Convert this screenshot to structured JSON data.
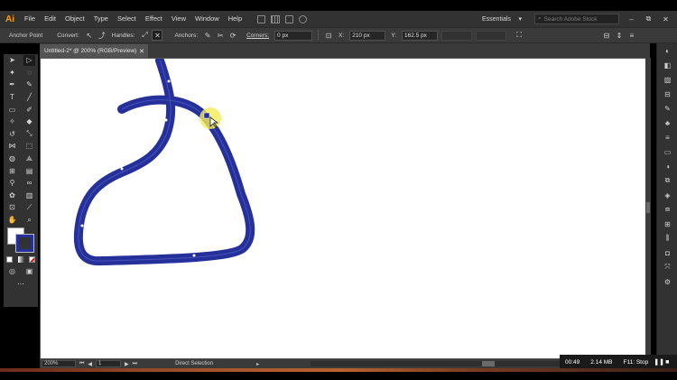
{
  "app": {
    "logo": "Ai"
  },
  "menu": [
    "File",
    "Edit",
    "Object",
    "Type",
    "Select",
    "Effect",
    "View",
    "Window",
    "Help"
  ],
  "workspace": {
    "label": "Essentials"
  },
  "search": {
    "placeholder": "Search Adobe Stock"
  },
  "window_buttons": [
    "–",
    "⧉",
    "✕"
  ],
  "control_bar": {
    "anchor_point": "Anchor Point",
    "convert": "Convert:",
    "handles": "Handles:",
    "anchors": "Anchors:",
    "corners": "Corners:",
    "corner_value": "0 px",
    "x_value": "210 px",
    "y_value": "162.5 px"
  },
  "document_tab": {
    "title": "Untitled-2* @ 200% (RGB/Preview)",
    "close": "✕"
  },
  "status_bar": {
    "zoom": "200%",
    "page": "1",
    "tool": "Direct Selection"
  },
  "recorder": {
    "time": "00:49",
    "size": "2.14 MB",
    "hotkey": "F11: Stop"
  },
  "colors": {
    "stroke": "#25309a",
    "cursor_highlight": "#f4ec57",
    "app_accent": "#ff9a00"
  },
  "icons": {
    "tools": [
      "selection-icon",
      "direct-selection-icon",
      "magic-wand-icon",
      "lasso-icon",
      "pen-icon",
      "curvature-icon",
      "type-icon",
      "line-segment-icon",
      "rectangle-icon",
      "paintbrush-icon",
      "shaper-icon",
      "eraser-icon",
      "rotate-icon",
      "scale-icon",
      "width-icon",
      "free-transform-icon",
      "shape-builder-icon",
      "perspective-grid-icon",
      "mesh-icon",
      "gradient-icon",
      "eyedropper-icon",
      "blend-icon",
      "symbol-sprayer-icon",
      "column-graph-icon",
      "artboard-icon",
      "slice-icon",
      "hand-icon",
      "zoom-icon"
    ],
    "dock": [
      "color-icon",
      "color-guide-icon",
      "cc-libraries-icon",
      "image-trace-icon",
      "brushes-icon",
      "symbols-icon",
      "stroke-icon",
      "gradient-panel-icon",
      "transparency-icon",
      "appearance-icon",
      "graphic-styles-icon",
      "layers-icon",
      "artboards-icon",
      "align-icon",
      "pathfinder-icon",
      "transform-icon",
      "links-icon"
    ]
  }
}
